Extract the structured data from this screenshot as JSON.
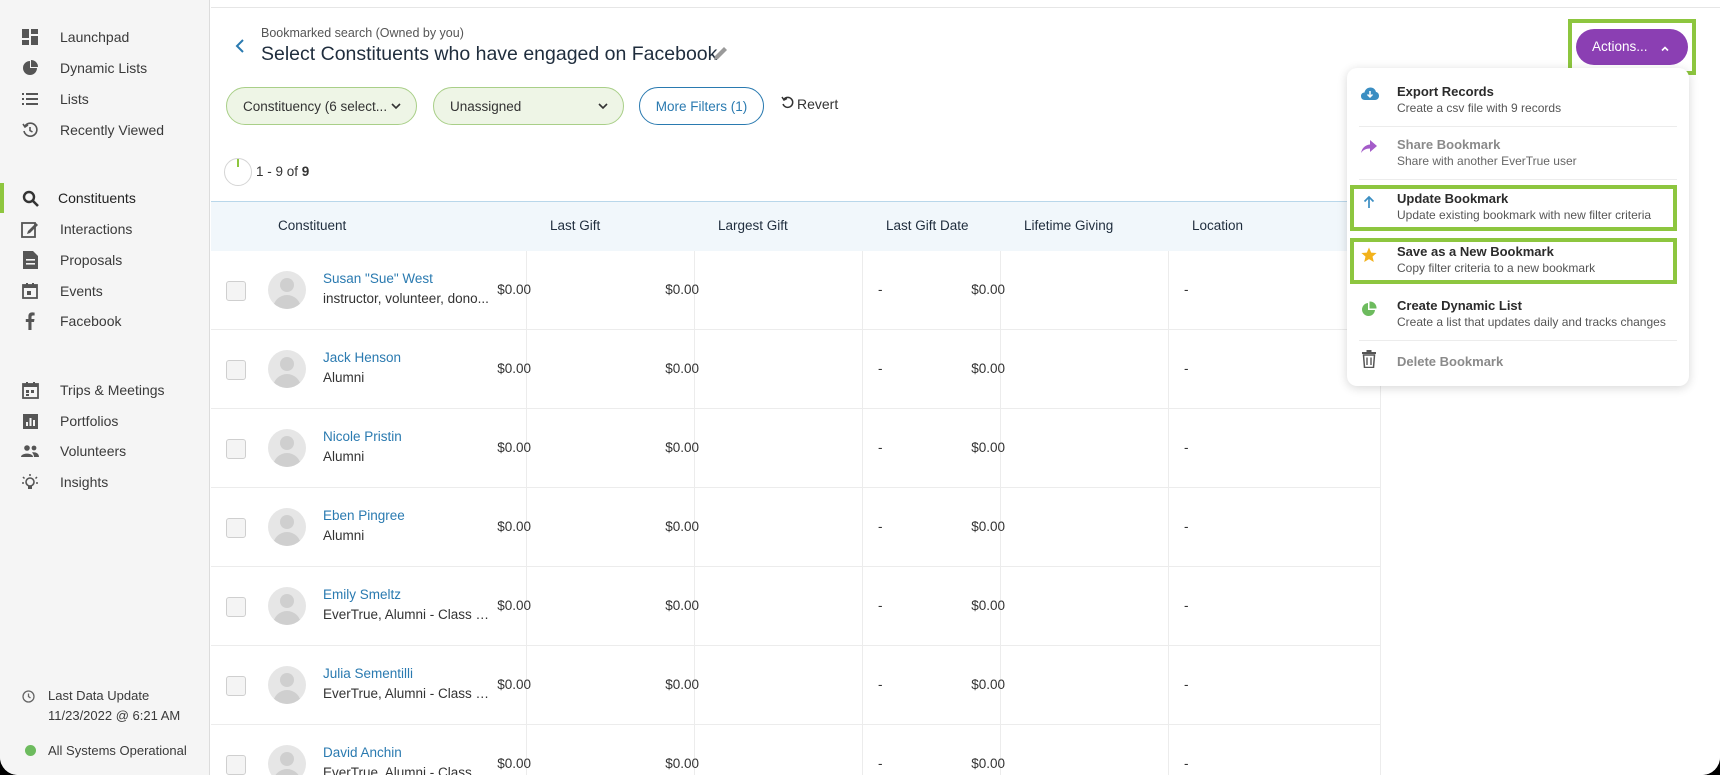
{
  "sidebar": {
    "items": [
      {
        "label": "Launchpad",
        "icon": "dashboard-icon"
      },
      {
        "label": "Dynamic Lists",
        "icon": "pie-chart-icon"
      },
      {
        "label": "Lists",
        "icon": "list-icon"
      },
      {
        "label": "Recently Viewed",
        "icon": "history-icon"
      },
      {
        "label": "Constituents",
        "icon": "search-icon"
      },
      {
        "label": "Interactions",
        "icon": "edit-icon"
      },
      {
        "label": "Proposals",
        "icon": "document-icon"
      },
      {
        "label": "Events",
        "icon": "calendar-icon"
      },
      {
        "label": "Facebook",
        "icon": "facebook-icon"
      },
      {
        "label": "Trips & Meetings",
        "icon": "calendar-trips-icon"
      },
      {
        "label": "Portfolios",
        "icon": "bar-chart-icon"
      },
      {
        "label": "Volunteers",
        "icon": "people-icon"
      },
      {
        "label": "Insights",
        "icon": "lightbulb-icon"
      }
    ],
    "last_update_label": "Last Data Update",
    "last_update_value": "11/23/2022 @ 6:21 AM",
    "status_text": "All Systems Operational",
    "status_color": "#6dbb5e"
  },
  "header": {
    "subtitle": "Bookmarked search (Owned by you)",
    "title": "Select Constituents who have engaged on Facebook"
  },
  "filters": {
    "constituency": "Constituency (6 select...",
    "assignment": "Unassigned",
    "more_filters": "More Filters (1)",
    "revert": "Revert"
  },
  "results": {
    "prefix": "1 - 9 of",
    "total": "9"
  },
  "table": {
    "headers": [
      "Constituent",
      "Last Gift",
      "Largest Gift",
      "Last Gift Date",
      "Lifetime Giving",
      "Location"
    ],
    "rows": [
      {
        "name": "Susan \"Sue\" West",
        "desc": "instructor, volunteer, dono...",
        "last_gift": "$0.00",
        "largest_gift": "$0.00",
        "last_gift_date": "-",
        "lifetime": "$0.00",
        "location": "-"
      },
      {
        "name": "Jack Henson",
        "desc": "Alumni",
        "last_gift": "$0.00",
        "largest_gift": "$0.00",
        "last_gift_date": "-",
        "lifetime": "$0.00",
        "location": "-"
      },
      {
        "name": "Nicole Pristin",
        "desc": "Alumni",
        "last_gift": "$0.00",
        "largest_gift": "$0.00",
        "last_gift_date": "-",
        "lifetime": "$0.00",
        "location": "-"
      },
      {
        "name": "Eben Pingree",
        "desc": "Alumni",
        "last_gift": "$0.00",
        "largest_gift": "$0.00",
        "last_gift_date": "-",
        "lifetime": "$0.00",
        "location": "-"
      },
      {
        "name": "Emily Smeltz",
        "desc": "EverTrue, Alumni - Class o...",
        "last_gift": "$0.00",
        "largest_gift": "$0.00",
        "last_gift_date": "-",
        "lifetime": "$0.00",
        "location": "-"
      },
      {
        "name": "Julia Sementilli",
        "desc": "EverTrue, Alumni - Class o...",
        "last_gift": "$0.00",
        "largest_gift": "$0.00",
        "last_gift_date": "-",
        "lifetime": "$0.00",
        "location": "-"
      },
      {
        "name": "David Anchin",
        "desc": "EverTrue, Alumni - Class o...",
        "last_gift": "$0.00",
        "largest_gift": "$0.00",
        "last_gift_date": "-",
        "lifetime": "$0.00",
        "location": "-"
      }
    ]
  },
  "actions": {
    "button_label": "Actions...",
    "accent_color": "#8b3fb3",
    "highlight_color": "#8dc63f",
    "menu": [
      {
        "title": "Export Records",
        "desc": "Create a csv file with 9 records",
        "icon": "cloud-download-icon",
        "color": "#3b8ec2"
      },
      {
        "title": "Share Bookmark",
        "desc": "Share with another EverTrue user",
        "icon": "share-icon",
        "color": "#a45cc9"
      },
      {
        "title": "Update Bookmark",
        "desc": "Update existing bookmark with new filter criteria",
        "icon": "arrow-up-icon",
        "color": "#3b8ec2"
      },
      {
        "title": "Save as a New Bookmark",
        "desc": "Copy filter criteria to a new bookmark",
        "icon": "star-icon",
        "color": "#f2b21b"
      },
      {
        "title": "Create Dynamic List",
        "desc": "Create a list that updates daily and tracks changes",
        "icon": "pie-chart-icon",
        "color": "#6dbb5e"
      },
      {
        "title": "Delete Bookmark",
        "desc": "",
        "icon": "trash-icon",
        "color": "#555555"
      }
    ]
  }
}
